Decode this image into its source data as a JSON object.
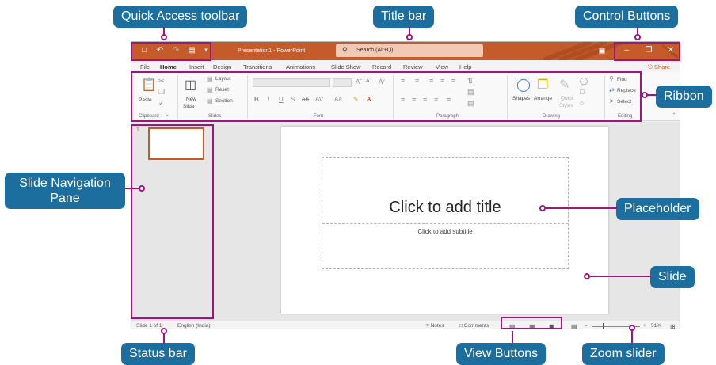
{
  "callouts": {
    "quick_access": "Quick Access toolbar",
    "title_bar": "Title bar",
    "control_buttons": "Control Buttons",
    "ribbon": "Ribbon",
    "slide_nav": "Slide Navigation Pane",
    "placeholder": "Placeholder",
    "slide": "Slide",
    "status_bar": "Status bar",
    "view_buttons": "View Buttons",
    "zoom_slider": "Zoom slider"
  },
  "window": {
    "title": "Presentation1 - PowerPoint",
    "search_placeholder": "Search (Alt+Q)",
    "share": "Share"
  },
  "tabs": [
    "File",
    "Home",
    "Insert",
    "Design",
    "Transitions",
    "Animations",
    "Slide Show",
    "Record",
    "Review",
    "View",
    "Help"
  ],
  "ribbon": {
    "clipboard": {
      "label": "Clipboard",
      "paste": "Paste"
    },
    "slides": {
      "label": "Slides",
      "new_slide": "New",
      "new_slide2": "Slide",
      "layout": "Layout",
      "reset": "Reset",
      "section": "Section"
    },
    "font": {
      "label": "Font"
    },
    "paragraph": {
      "label": "Paragraph"
    },
    "drawing": {
      "label": "Drawing",
      "shapes": "Shapes",
      "arrange": "Arrange",
      "quick": "Quick",
      "styles": "Styles"
    },
    "editing": {
      "label": "Editing",
      "find": "Find",
      "replace": "Replace",
      "select": "Select"
    }
  },
  "slide": {
    "number": "1",
    "title_placeholder": "Click to add title",
    "subtitle_placeholder": "Click to add subtitle"
  },
  "status": {
    "slide_count": "Slide 1 of 1",
    "language": "English (India)",
    "notes": "Notes",
    "comments": "Comments",
    "zoom": "51%"
  },
  "colors": {
    "accent": "#c55a2b",
    "callout": "#1b6e9e",
    "highlight": "#a0147f"
  }
}
